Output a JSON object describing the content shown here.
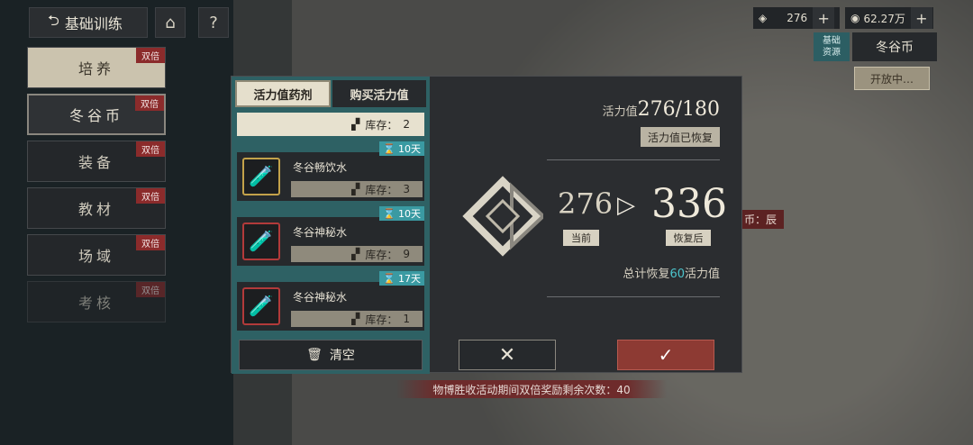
{
  "top": {
    "back_label": "基础训练",
    "home_icon": "⌂",
    "help_icon": "?",
    "vitality_amount": "276",
    "coin_amount": "62.27万",
    "plus": "+"
  },
  "right_panel": {
    "basic_line1": "基础",
    "basic_line2": "资源",
    "coin_tab": "冬谷币",
    "open_label": "开放中…",
    "world_tag": "币：辰"
  },
  "sidebar": {
    "items": [
      {
        "label": "培养",
        "badge": "双倍"
      },
      {
        "label": "冬谷币",
        "badge": "双倍"
      },
      {
        "label": "装备",
        "badge": "双倍"
      },
      {
        "label": "教材",
        "badge": "双倍"
      },
      {
        "label": "场域",
        "badge": "双倍"
      },
      {
        "label": "考核",
        "badge": "双倍"
      }
    ]
  },
  "dialog": {
    "tabs": [
      "活力值药剂",
      "购买活力值"
    ],
    "items": [
      {
        "name": "",
        "stock_label": "库存：",
        "stock": "2",
        "days": ""
      },
      {
        "name": "冬谷畅饮水",
        "stock_label": "库存：",
        "stock": "3",
        "days": "10天"
      },
      {
        "name": "冬谷神秘水",
        "stock_label": "库存：",
        "stock": "9",
        "days": "10天"
      },
      {
        "name": "冬谷神秘水",
        "stock_label": "库存：",
        "stock": "1",
        "days": "17天"
      }
    ],
    "clear_label": "清空",
    "vitality_label": "活力值",
    "vitality_current": "276",
    "vitality_max": "/180",
    "recovered_label": "活力值已恢复",
    "current_value": "276",
    "after_value": "336",
    "current_tag": "当前",
    "after_tag": "恢复后",
    "total_prefix": "总计恢复",
    "total_amount": "60",
    "total_suffix": "活力值"
  },
  "notice": "物博胜收活动期间双倍奖励剩余次数：40",
  "colors": {
    "accent_teal": "#2e6164",
    "confirm_red": "#8d3a33",
    "badge_red": "#8b2b2b"
  }
}
